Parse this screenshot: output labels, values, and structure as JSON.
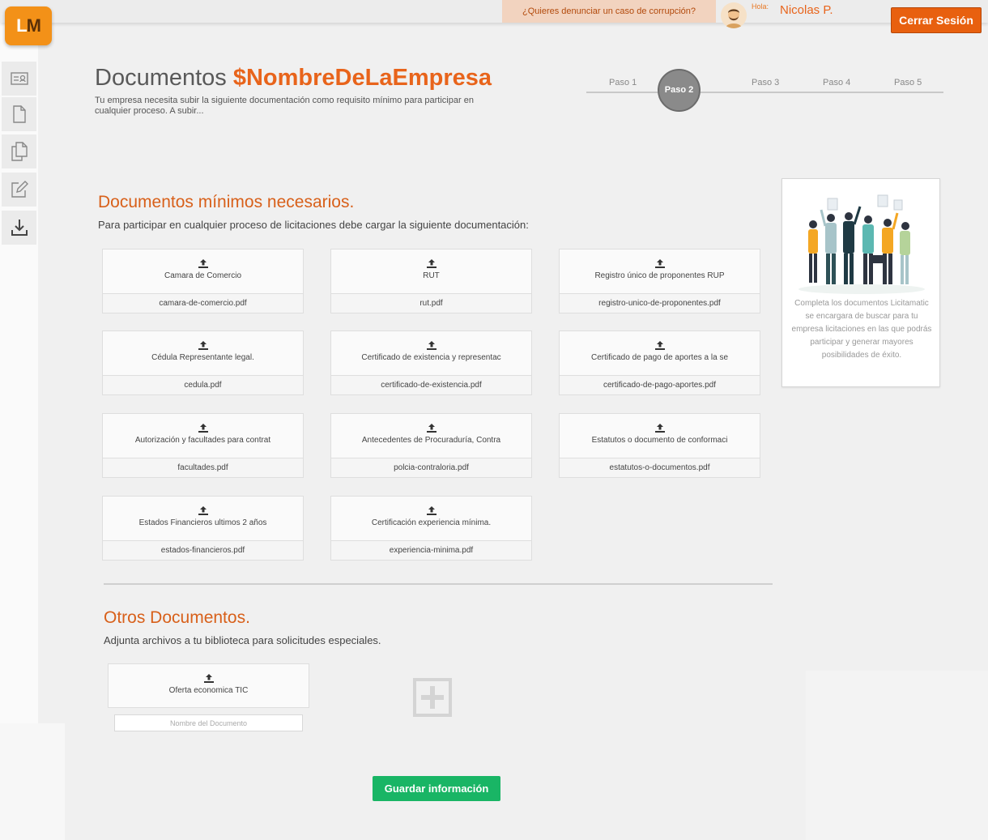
{
  "topbar": {
    "report_text": "¿Quieres denunciar un caso de corrupción?",
    "greeting": "Hola:",
    "user_name": "Nicolas P.",
    "logout_label": "Cerrar Sesión"
  },
  "logo": {
    "l": "L",
    "m": "M"
  },
  "sidebar": {
    "items": [
      {
        "icon": "id-card-icon"
      },
      {
        "icon": "document-icon"
      },
      {
        "icon": "documents-icon"
      },
      {
        "icon": "edit-icon"
      },
      {
        "icon": "download-icon"
      }
    ]
  },
  "header": {
    "title_prefix": "Documentos ",
    "title_company": "$NombreDeLaEmpresa",
    "subtitle": "Tu empresa necesita subir la siguiente documentación como requisito mínimo para participar en cualquier proceso. A subir..."
  },
  "steps": {
    "items": [
      "Paso 1",
      "Paso 2",
      "Paso 3",
      "Paso 4",
      "Paso 5"
    ],
    "active": "Paso 2"
  },
  "required": {
    "title": "Documentos mínimos necesarios.",
    "description": "Para participar en cualquier proceso de licitaciones debe cargar la siguiente documentación:",
    "docs": [
      {
        "label": "Camara de Comercio",
        "file": "camara-de-comercio.pdf"
      },
      {
        "label": "RUT",
        "file": "rut.pdf"
      },
      {
        "label": "Registro único de proponentes RUP",
        "file": "registro-unico-de-proponentes.pdf"
      },
      {
        "label": "Cédula Representante legal.",
        "file": "cedula.pdf"
      },
      {
        "label": "Certificado de existencia y representac",
        "file": "certificado-de-existencia.pdf"
      },
      {
        "label": "Certificado de pago de aportes a la se",
        "file": "certificado-de-pago-aportes.pdf"
      },
      {
        "label": "Autorización y facultades para contrat",
        "file": "facultades.pdf"
      },
      {
        "label": "Antecedentes de Procuraduría, Contra",
        "file": "polcia-contraloria.pdf"
      },
      {
        "label": "Estatutos o documento de conformaci",
        "file": "estatutos-o-documentos.pdf"
      },
      {
        "label": "Estados Financieros ultimos 2 años",
        "file": "estados-financieros.pdf"
      },
      {
        "label": "Certificación experiencia mínima.",
        "file": "experiencia-minima.pdf"
      }
    ]
  },
  "others": {
    "title": "Otros Documentos.",
    "description": "Adjunta archivos a tu biblioteca para solicitudes especiales.",
    "doc_label": "Oferta economica TIC",
    "name_placeholder": "Nombre del Documento"
  },
  "promo": {
    "text": "Completa los documentos Licitamatic se encargara de buscar para tu empresa licitaciones en las que podrás participar y generar mayores posibilidades de éxito."
  },
  "save_label": "Guardar información",
  "colors": {
    "accent": "#e8641b",
    "success": "#19b565",
    "logo": "#f39118"
  }
}
